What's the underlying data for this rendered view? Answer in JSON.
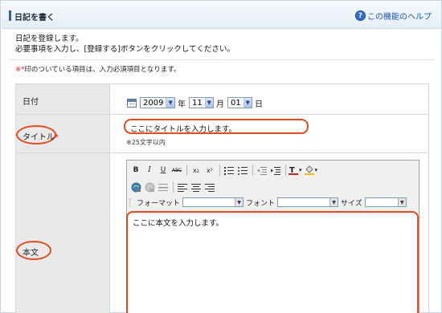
{
  "header": {
    "title": "日記を書く",
    "help_label": "この機能のヘルプ"
  },
  "intro": {
    "line1": "日記を登録します。",
    "line2": "必要事項を入力し、[登録する]ボタンをクリックしてください。"
  },
  "note": {
    "star": "※*",
    "text": "印のついている項目は、入力必須項目となります。"
  },
  "form": {
    "date": {
      "label": "日付",
      "year": "2009",
      "year_unit": "年",
      "month": "11",
      "month_unit": "月",
      "day": "01",
      "day_unit": "日"
    },
    "title_field": {
      "label": "タイトル",
      "required_mark": "*",
      "value": "ここにタイトルを入力します。",
      "hint": "※25文字以内"
    },
    "body_field": {
      "label": "本文",
      "value": "ここに本文を入力します。"
    }
  },
  "editor": {
    "bold": "B",
    "italic": "I",
    "underline": "U",
    "strike": "ABC",
    "subscript": "x₂",
    "superscript": "x²",
    "format_label": "フォーマット",
    "font_label": "フォント",
    "size_label": "サイズ"
  },
  "colors": {
    "accent": "#2b63b8",
    "highlight": "#e64a1e",
    "required": "#d42020",
    "label_bg": "#e9e9e9"
  }
}
